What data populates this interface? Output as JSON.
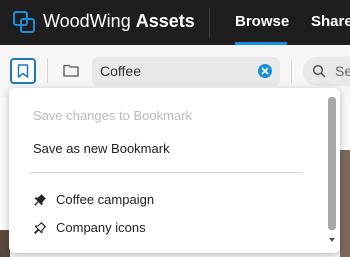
{
  "header": {
    "brand_name": "WoodWing",
    "brand_product": "Assets",
    "tabs": [
      {
        "label": "Browse",
        "active": true
      },
      {
        "label": "Share",
        "active": false
      }
    ]
  },
  "toolbar": {
    "search": {
      "value": "Coffee"
    },
    "search2": {
      "placeholder": "Se"
    }
  },
  "bookmark_menu": {
    "save_changes_label": "Save changes to Bookmark",
    "save_new_label": "Save as new Bookmark",
    "bookmarks": [
      {
        "label": "Coffee campaign",
        "icon": "pin-filled-icon",
        "pinned": true
      },
      {
        "label": "Company icons",
        "icon": "pin-outline-icon",
        "pinned": false
      }
    ]
  },
  "colors": {
    "topbar": "#1e1e1e",
    "accent": "#1a8ed8",
    "bookmark_border": "#1d77c2"
  }
}
